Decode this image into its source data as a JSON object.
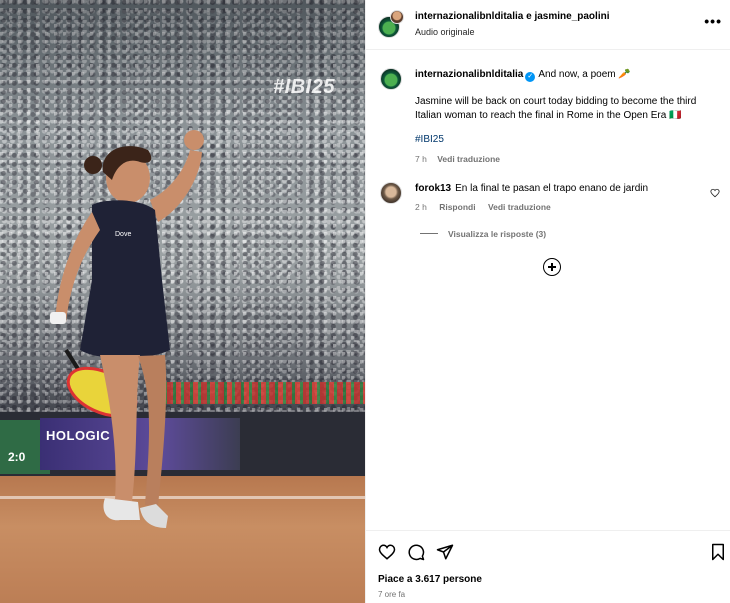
{
  "media": {
    "overlay_hashtag": "#IBI25",
    "hoarding_text": "HOLOGIC",
    "hoarding_score": "2:0"
  },
  "header": {
    "usernames": "internazionalibnlditalia e jasmine_paolini",
    "audio": "Audio originale",
    "more_icon": "more-horizontal-icon"
  },
  "caption": {
    "username": "internazionalibnlditalia",
    "verified_icon": "verified-badge-icon",
    "headline": "And now, a poem 🥕",
    "body": "Jasmine will be back on court today bidding to become the third Italian woman to reach the final in Rome in the Open Era 🇮🇹",
    "hashtag": "#IBI25",
    "time": "7 h",
    "translate": "Vedi traduzione"
  },
  "comment": {
    "username": "forok13",
    "text": "En la final te pasan el trapo enano de jardin",
    "time": "2 h",
    "reply": "Rispondi",
    "translate": "Vedi traduzione",
    "view_replies": "Visualizza le risposte (3)"
  },
  "actions": {
    "likes": "Piace a 3.617 persone",
    "time_ago": "7 ore fa"
  },
  "colors": {
    "link": "#00376b",
    "verified": "#0095f6",
    "muted": "#737373"
  }
}
